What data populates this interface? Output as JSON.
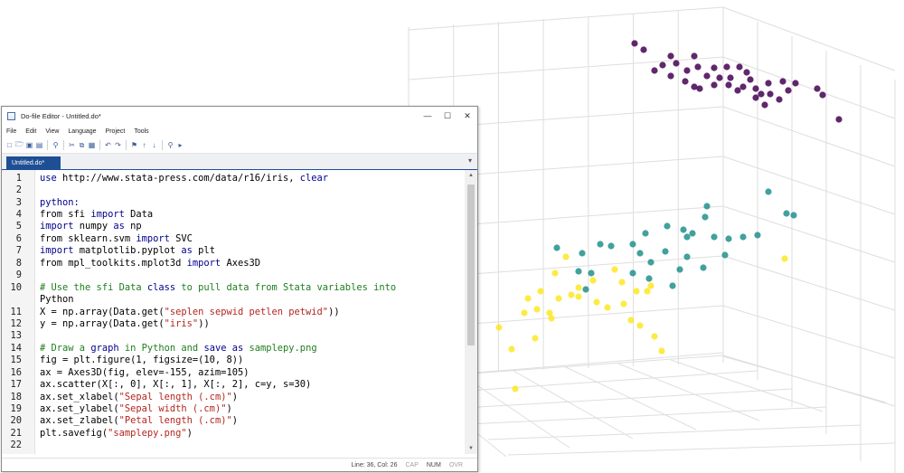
{
  "window": {
    "title": "Do-file Editor - Untitled.do*",
    "controls": {
      "minimize": "—",
      "maximize": "☐",
      "close": "✕"
    }
  },
  "menu": [
    "File",
    "Edit",
    "View",
    "Language",
    "Project",
    "Tools"
  ],
  "toolbar_icons": [
    "new-file-icon",
    "open-icon",
    "save-icon",
    "print-icon",
    "find-icon",
    "cut-icon",
    "copy-icon",
    "paste-icon",
    "undo-icon",
    "redo-icon",
    "bookmark-icon",
    "bookmark-prev-icon",
    "bookmark-next-icon",
    "help-icon",
    "execute-icon"
  ],
  "tab": {
    "label": "Untitled.do*",
    "dropdown": "▾"
  },
  "code_lines": [
    {
      "n": "1",
      "tokens": [
        {
          "t": "kw",
          "v": "use"
        },
        {
          "t": "tx",
          "v": " http://www.stata-press.com/data/r16/iris, "
        },
        {
          "t": "kw",
          "v": "clear"
        }
      ]
    },
    {
      "n": "2",
      "tokens": []
    },
    {
      "n": "3",
      "tokens": [
        {
          "t": "kw",
          "v": "python:"
        }
      ]
    },
    {
      "n": "4",
      "tokens": [
        {
          "t": "tx",
          "v": "from sfi "
        },
        {
          "t": "kw",
          "v": "import"
        },
        {
          "t": "tx",
          "v": " Data"
        }
      ]
    },
    {
      "n": "5",
      "tokens": [
        {
          "t": "kw",
          "v": "import"
        },
        {
          "t": "tx",
          "v": " numpy "
        },
        {
          "t": "kw",
          "v": "as"
        },
        {
          "t": "tx",
          "v": " np"
        }
      ]
    },
    {
      "n": "6",
      "tokens": [
        {
          "t": "tx",
          "v": "from sklearn.svm "
        },
        {
          "t": "kw",
          "v": "import"
        },
        {
          "t": "tx",
          "v": " SVC"
        }
      ]
    },
    {
      "n": "7",
      "tokens": [
        {
          "t": "kw",
          "v": "import"
        },
        {
          "t": "tx",
          "v": " matplotlib.pyplot "
        },
        {
          "t": "kw",
          "v": "as"
        },
        {
          "t": "tx",
          "v": " plt"
        }
      ]
    },
    {
      "n": "8",
      "tokens": [
        {
          "t": "tx",
          "v": "from mpl_toolkits.mplot3d "
        },
        {
          "t": "kw",
          "v": "import"
        },
        {
          "t": "tx",
          "v": " Axes3D"
        }
      ]
    },
    {
      "n": "9",
      "tokens": []
    },
    {
      "n": "10",
      "tokens": [
        {
          "t": "tx",
          "v": "# Use the sfi Data "
        },
        {
          "t": "kw",
          "v": "class"
        },
        {
          "t": "tx",
          "v": " to pull data from Stata variables into"
        }
      ]
    },
    {
      "n": "",
      "tokens": [
        {
          "t": "tx",
          "v": "Python"
        }
      ]
    },
    {
      "n": "11",
      "tokens": [
        {
          "t": "tx",
          "v": "X = np.array(Data.get("
        },
        {
          "t": "str",
          "v": "\"seplen sepwid petlen petwid\""
        },
        {
          "t": "tx",
          "v": "))"
        }
      ]
    },
    {
      "n": "12",
      "tokens": [
        {
          "t": "tx",
          "v": "y = np.array(Data.get("
        },
        {
          "t": "str",
          "v": "\"iris\""
        },
        {
          "t": "tx",
          "v": "))"
        }
      ]
    },
    {
      "n": "13",
      "tokens": []
    },
    {
      "n": "14",
      "tokens": [
        {
          "t": "tx",
          "v": "# Draw a "
        },
        {
          "t": "kw",
          "v": "graph"
        },
        {
          "t": "tx",
          "v": " in Python and "
        },
        {
          "t": "kw",
          "v": "save"
        },
        {
          "t": "tx",
          "v": " "
        },
        {
          "t": "kw",
          "v": "as"
        },
        {
          "t": "tx",
          "v": " samplepy.png"
        }
      ]
    },
    {
      "n": "15",
      "tokens": [
        {
          "t": "tx",
          "v": "fig = plt.figure(1, figsize=(10, 8))"
        }
      ]
    },
    {
      "n": "16",
      "tokens": [
        {
          "t": "tx",
          "v": "ax = Axes3D(fig, elev=-155, azim=105)"
        }
      ]
    },
    {
      "n": "17",
      "tokens": [
        {
          "t": "tx",
          "v": "ax.scatter(X[:, 0], X[:, 1], X[:, 2], c=y, s=30)"
        }
      ]
    },
    {
      "n": "18",
      "tokens": [
        {
          "t": "tx",
          "v": "ax.set_xlabel("
        },
        {
          "t": "str",
          "v": "\"Sepal length (.cm)\""
        },
        {
          "t": "tx",
          "v": ")"
        }
      ]
    },
    {
      "n": "19",
      "tokens": [
        {
          "t": "tx",
          "v": "ax.set_ylabel("
        },
        {
          "t": "str",
          "v": "\"Sepal width (.cm)\""
        },
        {
          "t": "tx",
          "v": ")"
        }
      ]
    },
    {
      "n": "20",
      "tokens": [
        {
          "t": "tx",
          "v": "ax.set_zlabel("
        },
        {
          "t": "str",
          "v": "\"Petal length (.cm)\""
        },
        {
          "t": "tx",
          "v": ")"
        }
      ]
    },
    {
      "n": "21",
      "tokens": [
        {
          "t": "tx",
          "v": "plt.savefig("
        },
        {
          "t": "str",
          "v": "\"samplepy.png\""
        },
        {
          "t": "tx",
          "v": ")"
        }
      ]
    },
    {
      "n": "22",
      "tokens": []
    }
  ],
  "status": {
    "position": "Line: 36, Col: 26",
    "cap": "CAP",
    "num": "NUM",
    "ovr": "OVR"
  },
  "colors": {
    "accent": "#1e4f95",
    "keyword": "#00008b",
    "comment": "#1d7e1d",
    "string": "#b3261e",
    "setosa": "#440154",
    "versicolor": "#21918c",
    "virginica": "#fde725"
  }
}
